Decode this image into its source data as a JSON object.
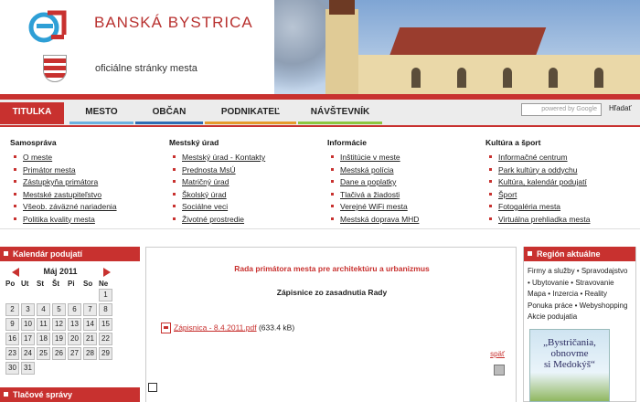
{
  "header": {
    "city_name": "BANSKÁ BYSTRICA",
    "subtitle": "oficiálne stránky mesta"
  },
  "nav": {
    "tabs": [
      {
        "label": "TITULKA",
        "color": "#c8312f"
      },
      {
        "label": "MESTO",
        "color": "#6bb1e0"
      },
      {
        "label": "OBČAN",
        "color": "#2e6db4"
      },
      {
        "label": "PODNIKATEĽ",
        "color": "#e59a2b"
      },
      {
        "label": "NÁVŠTEVNÍK",
        "color": "#8cc63f"
      }
    ],
    "search_placeholder": "powered by Google",
    "search_button": "Hľadať"
  },
  "menus": [
    {
      "title": "Samospráva",
      "items": [
        "O meste",
        "Primátor mesta",
        "Zástupkyňa primátora",
        "Mestské zastupiteľstvo",
        "Všeob. záväzné nariadenia",
        "Politika kvality mesta"
      ]
    },
    {
      "title": "Mestský úrad",
      "items": [
        "Mestský úrad - Kontakty",
        "Prednosta MsÚ",
        "Matričný úrad",
        "Školský úrad",
        "Sociálne veci",
        "Životné prostredie"
      ]
    },
    {
      "title": "Informácie",
      "items": [
        "Inštitúcie v meste",
        "Mestská polícia",
        "Dane a poplatky",
        "Tlačivá a žiadosti",
        "Verejné WiFi mesta",
        "Mestská doprava MHD"
      ]
    },
    {
      "title": "Kultúra a šport",
      "items": [
        "Informačné centrum",
        "Park kultúry a oddychu",
        "Kultúra, kalendár podujatí",
        "Šport",
        "Fotogaléria mesta",
        "Virtuálna prehliadka mesta"
      ]
    }
  ],
  "calendar": {
    "heading": "Kalendár podujatí",
    "month": "Máj 2011",
    "weekdays": [
      "Po",
      "Ut",
      "St",
      "Št",
      "Pi",
      "So",
      "Ne"
    ],
    "days": [
      "",
      "",
      "",
      "",
      "",
      "",
      "1",
      "2",
      "3",
      "4",
      "5",
      "6",
      "7",
      "8",
      "9",
      "10",
      "11",
      "12",
      "13",
      "14",
      "15",
      "16",
      "17",
      "18",
      "19",
      "20",
      "21",
      "22",
      "23",
      "24",
      "25",
      "26",
      "27",
      "28",
      "29",
      "30",
      "31",
      "",
      "",
      "",
      "",
      ""
    ]
  },
  "press": {
    "heading": "Tlačové správy"
  },
  "main": {
    "title": "Rada primátora mesta pre architektúru a urbanizmus",
    "subtitle": "Zápisnice zo zasadnutia Rady",
    "file_link": "Zápisnica - 8.4.2011.pdf",
    "file_size": "(633.4 kB)",
    "back_link": "späť"
  },
  "region": {
    "heading": "Región aktuálne",
    "links": [
      "Firmy a služby",
      "Spravodajstvo",
      "Ubytovanie",
      "Stravovanie",
      "Mapa",
      "Inzercia",
      "Reality",
      "Ponuka práce",
      "Webyshopping",
      "Akcie podujatia"
    ],
    "ad_text": [
      "„Bystričania,",
      "obnovme",
      "si Medokýš“"
    ]
  }
}
